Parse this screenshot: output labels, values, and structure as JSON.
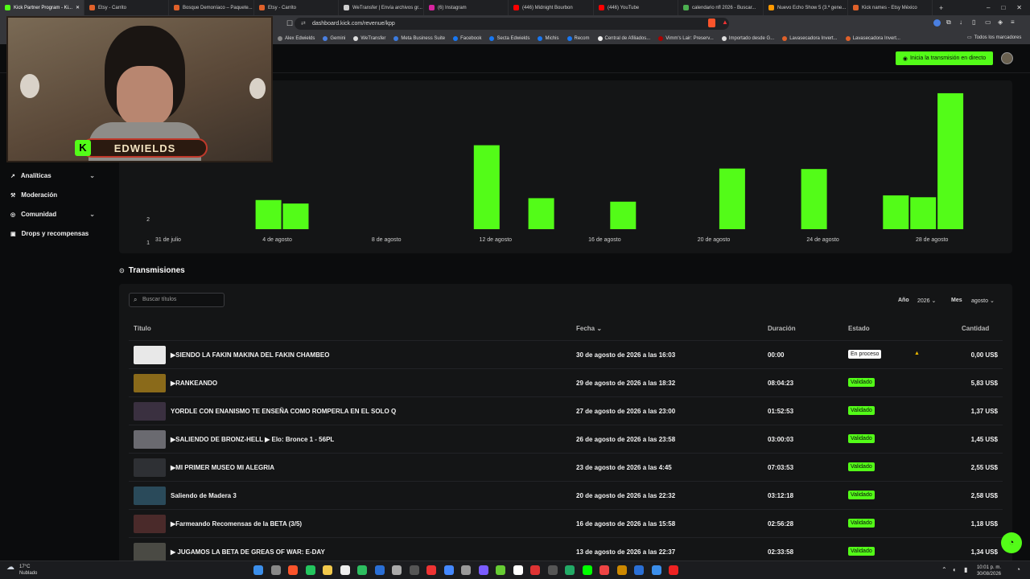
{
  "browser": {
    "tabs": [
      {
        "label": "Kick Partner Program - Ki...",
        "active": true
      },
      {
        "label": "Etsy - Carrito"
      },
      {
        "label": "Bosque Demoníaco – Paquete..."
      },
      {
        "label": "Etsy - Carrito"
      },
      {
        "label": "WeTransfer | Envía archivos gr..."
      },
      {
        "label": "(6) Instagram"
      },
      {
        "label": "(446) Midnight Bourbon"
      },
      {
        "label": "(446) YouTube"
      },
      {
        "label": "calendario nfl 2026 - Buscar..."
      },
      {
        "label": "Nuevo Echo Show 5 (3.ª gene..."
      },
      {
        "label": "Kick names - Etsy México"
      }
    ],
    "url": "dashboard.kick.com/revenue/kpp",
    "bookmarks": [
      "Alex Edwields",
      "Gemini",
      "WeTransfer",
      "Meta Business Suite",
      "Facebook",
      "Secta Edwields",
      "Michis",
      "Recom",
      "Central de Afiliados...",
      "Vimm's Lair: Preserv...",
      "Importado desde G...",
      "Lavasecadora Invert...",
      "Lavasecadora Invert..."
    ],
    "all_bookmarks": "Todos los marcadores"
  },
  "header": {
    "golive_label": "Inicia la transmisión en directo"
  },
  "webcam": {
    "overlay_text": "EDWIELDS"
  },
  "sidebar": {
    "items": [
      {
        "label": "Analíticas",
        "has_chevron": true
      },
      {
        "label": "Moderación",
        "has_chevron": false
      },
      {
        "label": "Comunidad",
        "has_chevron": true
      },
      {
        "label": "Drops y recompensas",
        "has_chevron": false
      }
    ]
  },
  "chart_data": {
    "type": "bar",
    "y_tick_labels": [
      "1",
      "2"
    ],
    "x_tick_labels": [
      "31 de julio",
      "4 de agosto",
      "8 de agosto",
      "12 de agosto",
      "16 de agosto",
      "20 de agosto",
      "24 de agosto",
      "28 de agosto"
    ],
    "categories": [
      "31 jul",
      "1 ago",
      "2 ago",
      "3 ago",
      "4 ago",
      "5 ago",
      "6 ago",
      "7 ago",
      "8 ago",
      "9 ago",
      "10 ago",
      "11 ago",
      "12 ago",
      "13 ago",
      "14 ago",
      "15 ago",
      "16 ago",
      "17 ago",
      "18 ago",
      "19 ago",
      "20 ago",
      "21 ago",
      "22 ago",
      "23 ago",
      "24 ago",
      "25 ago",
      "26 ago",
      "27 ago",
      "28 ago",
      "29 ago",
      "30 ago"
    ],
    "values": [
      0,
      0,
      0,
      0,
      1.25,
      1.1,
      0,
      0,
      0,
      0,
      0,
      0,
      3.6,
      0,
      1.33,
      0,
      0,
      1.18,
      0,
      0,
      0,
      2.6,
      0,
      0,
      2.58,
      0,
      0,
      1.45,
      1.37,
      5.83,
      0
    ],
    "ylim": [
      0,
      6
    ],
    "bar_color": "#53fc18"
  },
  "transmissions": {
    "title": "Transmisiones",
    "search_placeholder": "Buscar títulos",
    "year_label": "Año",
    "year_value": "2026",
    "month_label": "Mes",
    "month_value": "agosto",
    "columns": {
      "title": "Título",
      "date": "Fecha",
      "duration": "Duración",
      "status": "Estado",
      "amount": "Cantidad"
    },
    "rows": [
      {
        "title": "▶SIENDO LA FAKIN MAKINA DEL FAKIN CHAMBEO",
        "date": "30 de agosto de 2026 a las 16:03",
        "duration": "00:00",
        "status": "En proceso",
        "amount": "0,00 US$",
        "thumb": "#e8e8e8"
      },
      {
        "title": "▶RANKEANDO",
        "date": "29 de agosto de 2026 a las 18:32",
        "duration": "08:04:23",
        "status": "Validado",
        "amount": "5,83 US$",
        "thumb": "#8a6a1a"
      },
      {
        "title": "YORDLE CON ENANISMO TE ENSEÑA COMO ROMPERLA EN EL SOLO Q",
        "date": "27 de agosto de 2026 a las 23:00",
        "duration": "01:52:53",
        "status": "Validado",
        "amount": "1,37 US$",
        "thumb": "#3a3040"
      },
      {
        "title": "▶SALIENDO DE BRONZ-HELL ▶ Elo: Bronce 1 - 56PL",
        "date": "26 de agosto de 2026 a las 23:58",
        "duration": "03:00:03",
        "status": "Validado",
        "amount": "1,45 US$",
        "thumb": "#6a6a70"
      },
      {
        "title": "▶MI PRIMER MUSEO MI ALEGRIA",
        "date": "23 de agosto de 2026 a las 4:45",
        "duration": "07:03:53",
        "status": "Validado",
        "amount": "2,55 US$",
        "thumb": "#2e3034"
      },
      {
        "title": "Saliendo de Madera 3",
        "date": "20 de agosto de 2026 a las 22:32",
        "duration": "03:12:18",
        "status": "Validado",
        "amount": "2,58 US$",
        "thumb": "#2a4a5a"
      },
      {
        "title": "▶Farmeando Recomensas de la BETA (3/5)",
        "date": "16 de agosto de 2026 a las 15:58",
        "duration": "02:56:28",
        "status": "Validado",
        "amount": "1,18 US$",
        "thumb": "#4a2a2a"
      },
      {
        "title": "▶ JUGAMOS LA BETA DE GREAS OF WAR: E-DAY",
        "date": "13 de agosto de 2026 a las 22:37",
        "duration": "02:33:58",
        "status": "Validado",
        "amount": "1,34 US$",
        "thumb": "#4a4a44"
      }
    ]
  },
  "taskbar": {
    "temp": "17°C",
    "weather": "Nublado",
    "time": "10:01 p. m.",
    "date": "30/08/2026"
  }
}
